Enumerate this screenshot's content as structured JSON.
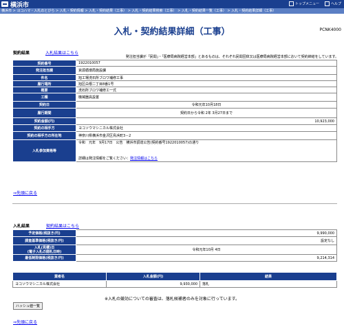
{
  "header": {
    "site_name": "横浜市",
    "nav": [
      "トップメニュー",
      "ヘルプ"
    ],
    "breadcrumb": "横浜市 > ヨコハマ・入札のとびら > 入札・契約情報 > 入札・契約結果（工事） > 入札・契約結果検索（工事） > 入札・契約結果一覧（工事） > 入札・契約結果詳細（工事）"
  },
  "page": {
    "title": "入札・契約結果詳細（工事）",
    "page_id": "PCNK4000"
  },
  "contract": {
    "heading": "契約結果",
    "link": "入札結果はこちら",
    "note": "発注担当課が「民間」・「医療局病院経営本部」とあるものは、それぞれ民間団体又は医療局病院経営本部において契約締結をしています。",
    "rows": [
      {
        "label": "契約番号",
        "value": "1922010057"
      },
      {
        "label": "発注担当課",
        "value": "資源循環局施設課"
      },
      {
        "label": "件名",
        "value": "旭工場洗石所ブロワ補修工事"
      },
      {
        "label": "履行場所",
        "value": "旭区白根二丁目8番1号"
      },
      {
        "label": "概要",
        "value": "洗石所ブロワ補修工一式"
      },
      {
        "label": "工種",
        "value": "機械器具設置"
      },
      {
        "label": "契約日",
        "value": "令和元年10月18日"
      },
      {
        "label": "履行期間",
        "value": "契約日から令和 2年 3月27日まで"
      },
      {
        "label": "契約金額(円)",
        "value": "10,923,000"
      },
      {
        "label": "契約の相手方",
        "value": "ヨコソウマシニカル株式会社"
      },
      {
        "label": "契約の相手方の所在地",
        "value": "神奈川県横浜市金沢区鳥浜町3－2"
      }
    ],
    "participation": {
      "label": "入札参加資格等",
      "text": "令和　元年　9月17日　公告　横浜市調達公告(契約番号1922010057)の通り",
      "detail_prefix": "詳細は発注情報をご覧ください：",
      "detail_link": "発注情報はこちら"
    },
    "back": "⇒先頭に戻る"
  },
  "bid": {
    "heading": "入札結果",
    "link": "契約結果はこちら",
    "rows": [
      {
        "label": "予定価格(税抜き/円)",
        "value": "9,990,000"
      },
      {
        "label": "調査基準価格(税抜き/円)",
        "value": "設定なし"
      },
      {
        "label": "入札(見積)日\n(電子入札の開札日時)",
        "value": "令和元年10月 4日"
      },
      {
        "label": "最低制限価格(税抜き/円)",
        "value": "9,214,314"
      }
    ],
    "result_headers": [
      "業者名",
      "入札金額(円)",
      "結果"
    ],
    "result_rows": [
      {
        "name": "ヨコソウマシニカル株式会社",
        "amount": "9,930,000",
        "result": "落札"
      }
    ],
    "footnote": "※入札の競効についての審査は、落札候補者のみを対象に行っています。",
    "hash_button": "ハッシュ値一覧",
    "back": "⇒先頭に戻る"
  }
}
